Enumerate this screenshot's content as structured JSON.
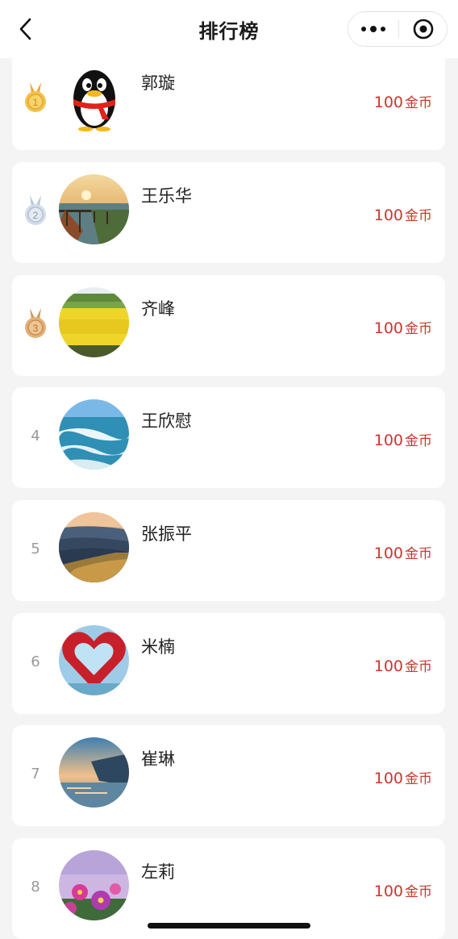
{
  "header": {
    "title": "排行榜",
    "back_icon": "chevron-left-icon",
    "more_icon": "more-dots-icon",
    "close_icon": "target-close-icon"
  },
  "colors": {
    "coin_text": "#c8382f",
    "gold_medal": "#e8b84a",
    "silver_medal": "#c9d3e0",
    "bronze_medal": "#d9a86a"
  },
  "entries": [
    {
      "rank": "1",
      "medal": "gold-medal-icon",
      "name": "郭璇",
      "coins": "100",
      "unit": "金币",
      "avatar": "qq-penguin-avatar"
    },
    {
      "rank": "2",
      "medal": "silver-medal-icon",
      "name": "王乐华",
      "coins": "100",
      "unit": "金币",
      "avatar": "lake-sunset-avatar"
    },
    {
      "rank": "3",
      "medal": "bronze-medal-icon",
      "name": "齐峰",
      "coins": "100",
      "unit": "金币",
      "avatar": "rapeseed-field-avatar"
    },
    {
      "rank": "4",
      "medal": "",
      "name": "王欣慰",
      "coins": "100",
      "unit": "金币",
      "avatar": "ocean-waves-avatar"
    },
    {
      "rank": "5",
      "medal": "",
      "name": "张振平",
      "coins": "100",
      "unit": "金币",
      "avatar": "misty-hills-avatar"
    },
    {
      "rank": "6",
      "medal": "",
      "name": "米楠",
      "coins": "100",
      "unit": "金币",
      "avatar": "red-heart-avatar"
    },
    {
      "rank": "7",
      "medal": "",
      "name": "崔琳",
      "coins": "100",
      "unit": "金币",
      "avatar": "coastal-dusk-avatar"
    },
    {
      "rank": "8",
      "medal": "",
      "name": "左莉",
      "coins": "100",
      "unit": "金币",
      "avatar": "pink-flowers-avatar"
    }
  ]
}
